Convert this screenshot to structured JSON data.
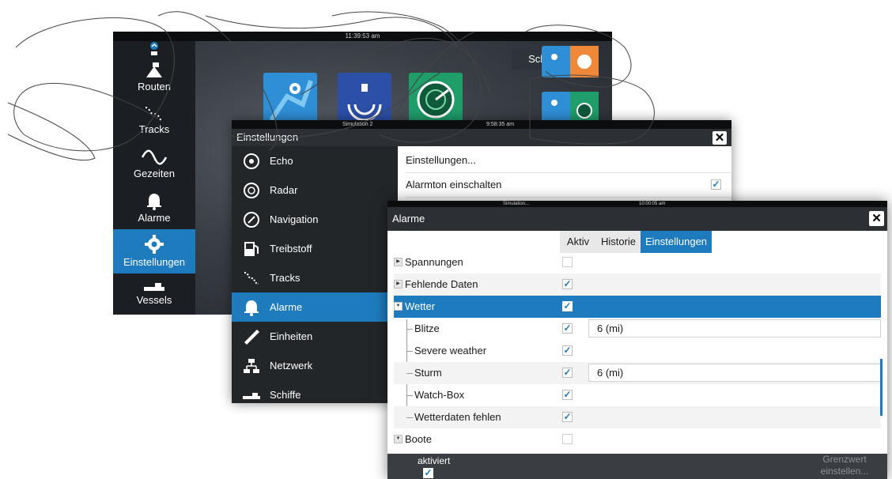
{
  "home": {
    "status_time": "11:39:53 am",
    "sidebar": [
      {
        "label": "",
        "icon": "top-icon"
      },
      {
        "label": "Routen",
        "icon": "routes-icon"
      },
      {
        "label": "Tracks",
        "icon": "tracks-icon"
      },
      {
        "label": "Gezeiten",
        "icon": "tides-icon"
      },
      {
        "label": "Alarme",
        "icon": "bell-icon"
      },
      {
        "label": "Einstellungen",
        "icon": "gear-icon",
        "active": true
      },
      {
        "label": "Vessels",
        "icon": "vessels-icon"
      }
    ],
    "close_label": "Schließen",
    "apps": [
      "chart-app-icon",
      "sonar-app-icon",
      "radar-app-icon",
      "chart-sonar-split-icon",
      "chart-radar-split-icon"
    ]
  },
  "settings": {
    "status_left": "Simulation 2",
    "status_time": "9:58:35 am",
    "title": "Einstellungen",
    "sidebar": [
      {
        "label": "Echo",
        "icon": "echo-icon"
      },
      {
        "label": "Radar",
        "icon": "radar-icon"
      },
      {
        "label": "Navigation",
        "icon": "compass-icon"
      },
      {
        "label": "Treibstoff",
        "icon": "fuel-icon"
      },
      {
        "label": "Tracks",
        "icon": "tracks-icon"
      },
      {
        "label": "Alarme",
        "icon": "bell-icon",
        "active": true
      },
      {
        "label": "Einheiten",
        "icon": "ruler-icon"
      },
      {
        "label": "Netzwerk",
        "icon": "network-icon"
      },
      {
        "label": "Schiffe",
        "icon": "vessels-icon"
      }
    ],
    "content": [
      {
        "label": "Einstellungen...",
        "checked": null
      },
      {
        "label": "Alarmton einschalten",
        "checked": true
      }
    ]
  },
  "alarms": {
    "status_left": "Simulation...",
    "status_time": "10:00:05 am",
    "title": "Alarme",
    "tabs": [
      "Aktiv",
      "Historie",
      "Einstellungen"
    ],
    "active_tab": "Einstellungen",
    "rows": [
      {
        "label": "Spannungen",
        "checked": false,
        "level": 0,
        "expander": "collapsed"
      },
      {
        "label": "Fehlende Daten",
        "checked": true,
        "level": 0,
        "expander": "collapsed"
      },
      {
        "label": "Wetter",
        "checked": true,
        "level": 0,
        "expander": "expanded",
        "selected": true
      },
      {
        "label": "Blitze",
        "checked": true,
        "level": 1,
        "limit": "6 (mi)"
      },
      {
        "label": "Severe weather",
        "checked": true,
        "level": 1
      },
      {
        "label": "Sturm",
        "checked": true,
        "level": 1,
        "limit": "6 (mi)"
      },
      {
        "label": "Watch-Box",
        "checked": true,
        "level": 1
      },
      {
        "label": "Wetterdaten fehlen",
        "checked": true,
        "level": 1
      },
      {
        "label": "Boote",
        "checked": false,
        "level": 0,
        "expander": "expanded"
      }
    ],
    "footer": {
      "enabled_label": "aktiviert",
      "enabled": true,
      "threshold_button": "Grenzwert einstellen..."
    }
  },
  "colors": {
    "accent": "#1e7bbd",
    "dark_bar": "#2c2f33",
    "sidebar": "#232629"
  }
}
